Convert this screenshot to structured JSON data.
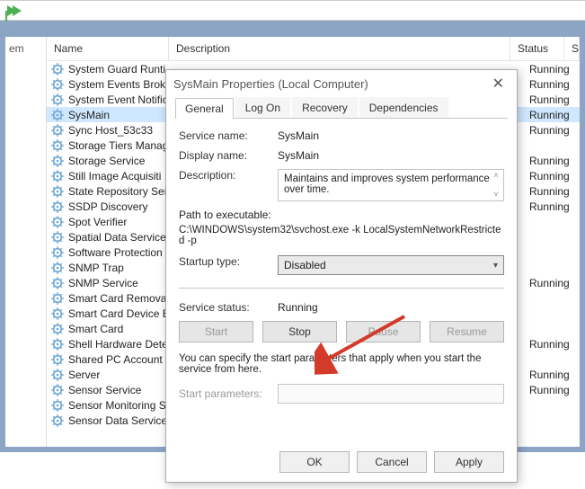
{
  "ribbon": {
    "play_icon": "play-icon"
  },
  "left_cell_suffix": "em",
  "columns": {
    "name": "Name",
    "description": "Description",
    "status": "Status",
    "startup": "S"
  },
  "services": [
    {
      "name": "System Guard Runti",
      "status": "Running"
    },
    {
      "name": "System Events Broke",
      "status": "Running"
    },
    {
      "name": "System Event Notific",
      "status": "Running"
    },
    {
      "name": "SysMain",
      "status": "Running",
      "selected": true
    },
    {
      "name": "Sync Host_53c33",
      "status": "Running"
    },
    {
      "name": "Storage Tiers Manag",
      "status": ""
    },
    {
      "name": "Storage Service",
      "status": "Running"
    },
    {
      "name": "Still Image Acquisiti",
      "status": "Running"
    },
    {
      "name": "State Repository Ser",
      "status": "Running"
    },
    {
      "name": "SSDP Discovery",
      "status": "Running"
    },
    {
      "name": "Spot Verifier",
      "status": ""
    },
    {
      "name": "Spatial Data Service",
      "status": ""
    },
    {
      "name": "Software Protection",
      "status": ""
    },
    {
      "name": "SNMP Trap",
      "status": ""
    },
    {
      "name": "SNMP Service",
      "status": "Running"
    },
    {
      "name": "Smart Card Removal",
      "status": ""
    },
    {
      "name": "Smart Card Device E",
      "status": ""
    },
    {
      "name": "Smart Card",
      "status": ""
    },
    {
      "name": "Shell Hardware Dete",
      "status": "Running"
    },
    {
      "name": "Shared PC Account",
      "status": ""
    },
    {
      "name": "Server",
      "status": "Running"
    },
    {
      "name": "Sensor Service",
      "status": "Running"
    },
    {
      "name": "Sensor Monitoring S",
      "status": ""
    },
    {
      "name": "Sensor Data Service",
      "status": ""
    }
  ],
  "dialog": {
    "title": "SysMain Properties (Local Computer)",
    "tabs": [
      "General",
      "Log On",
      "Recovery",
      "Dependencies"
    ],
    "active_tab": 0,
    "labels": {
      "service_name": "Service name:",
      "display_name": "Display name:",
      "description": "Description:",
      "path_label": "Path to executable:",
      "startup_type": "Startup type:",
      "service_status": "Service status:",
      "note": "You can specify the start parameters that apply when you start the service from here.",
      "start_params": "Start parameters:"
    },
    "values": {
      "service_name": "SysMain",
      "display_name": "SysMain",
      "description": "Maintains and improves system performance over time.",
      "path": "C:\\WINDOWS\\system32\\svchost.exe -k LocalSystemNetworkRestricted -p",
      "startup_type": "Disabled",
      "service_status": "Running",
      "start_params": ""
    },
    "buttons": {
      "start": "Start",
      "stop": "Stop",
      "pause": "Pause",
      "resume": "Resume",
      "ok": "OK",
      "cancel": "Cancel",
      "apply": "Apply"
    }
  }
}
